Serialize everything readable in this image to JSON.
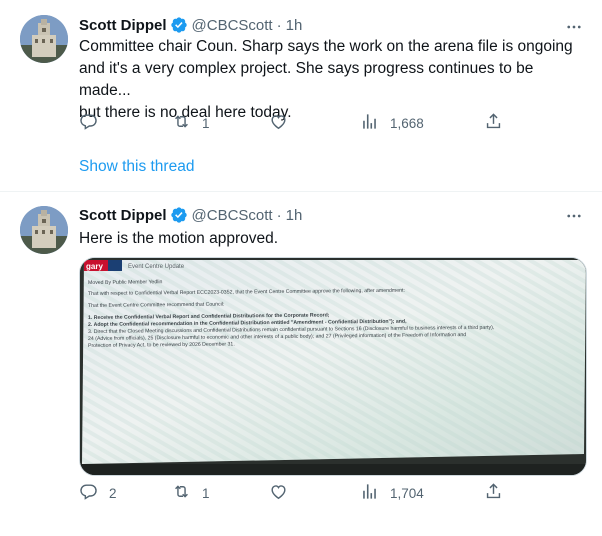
{
  "tweets": [
    {
      "author": "Scott Dippel",
      "handle": "@CBCScott",
      "time": "1h",
      "text": "Committee chair Coun. Sharp says the work on the arena file is ongoing\nand it's a very complex project. She says progress continues to be made...\nbut there is no deal here today.",
      "replies": "",
      "retweets": "1",
      "likes": "",
      "views": "1,668",
      "show_thread": "Show this thread"
    },
    {
      "author": "Scott Dippel",
      "handle": "@CBCScott",
      "time": "1h",
      "text": "Here is the motion approved.",
      "replies": "2",
      "retweets": "1",
      "likes": "",
      "views": "1,704",
      "media": {
        "tab_label": "gary",
        "tab_title": "Event Centre Update",
        "lines": [
          "Moved By Public Member Yedlin",
          "That with respect to Confidential Verbal Report ECC2023-0352, that the Event Centre Committee approve the following, after amendment:",
          "That the Event Centre Committee recommend that Council:",
          "1. Receive the Confidential Verbal Report and Confidential Distributions for the Corporate Record;",
          "2. Adopt the Confidential recommendation in the Confidential Distribution entitled \"Amendment - Confidential Distribution\"); and,",
          "3. Direct that the Closed Meeting discussions and Confidential Distributions remain confidential pursuant to Sections 16 (Disclosure harmful to business interests of a third party),",
          "24 (Advice from officials), 25 (Disclosure harmful to economic and other interests of a public body); and 27 (Privileged information) of the Freedom of Information and",
          "Protection of Privacy Act, to be reviewed by 2026 December 31."
        ]
      }
    }
  ],
  "colors": {
    "text": "#0f1419",
    "secondary": "#536471",
    "link": "#1d9bf0",
    "verified": "#1d9bf0",
    "divider": "#eff3f4"
  },
  "icons": {
    "reply": "reply-icon",
    "retweet": "retweet-icon",
    "like": "heart-icon",
    "views": "views-icon",
    "share": "share-icon",
    "more": "more-icon",
    "verified": "verified-badge-icon"
  }
}
